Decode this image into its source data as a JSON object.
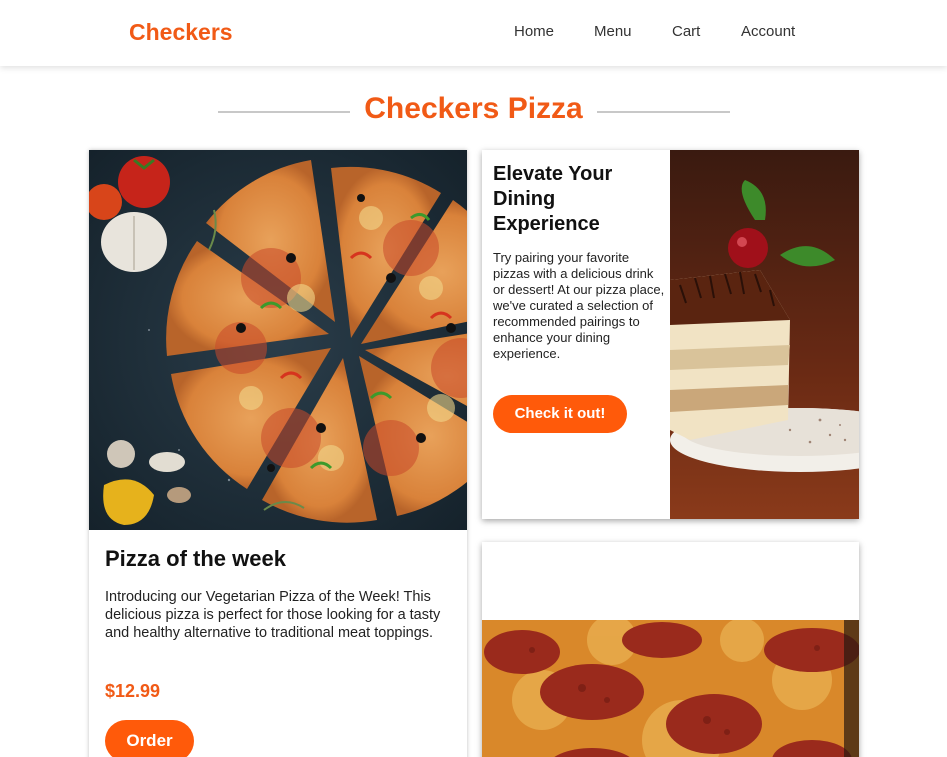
{
  "header": {
    "brand": "Checkers",
    "nav": [
      {
        "label": "Home"
      },
      {
        "label": "Menu"
      },
      {
        "label": "Cart"
      },
      {
        "label": "Account"
      }
    ]
  },
  "page": {
    "title": "Checkers Pizza"
  },
  "featured": {
    "title": "Pizza of the week",
    "description": "Introducing our Vegetarian Pizza of the Week! This delicious pizza is perfect for those looking for a tasty and healthy alternative to traditional meat toppings.",
    "price": "$12.99",
    "button_label": "Order",
    "image": "pizza-photo"
  },
  "pairing": {
    "title": "Elevate Your Dining Experience",
    "description": "Try pairing your favorite pizzas with a delicious drink or dessert! At our pizza place, we've curated a selection of recommended pairings to enhance your dining experience.",
    "button_label": "Check it out!",
    "image": "cake-photo"
  },
  "third_card": {
    "image": "pepperoni-pizza-photo"
  },
  "colors": {
    "accent": "#f15a16",
    "button": "#ff5a0a"
  }
}
